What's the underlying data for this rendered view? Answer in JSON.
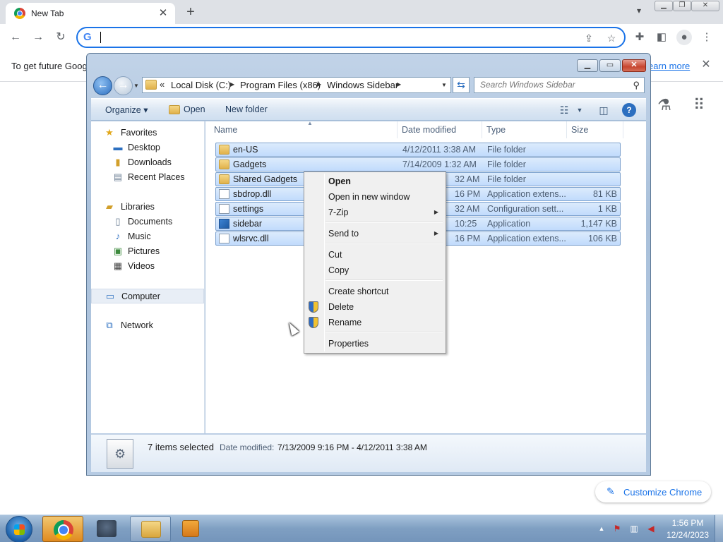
{
  "chrome": {
    "tab_title": "New Tab",
    "omnibox_value": "",
    "infobar_text": "To get future Goog",
    "infobar_link": "earn more",
    "customize_label": "Customize Chrome"
  },
  "explorer": {
    "breadcrumb": [
      "Local Disk (C:)",
      "Program Files (x86)",
      "Windows Sidebar"
    ],
    "search_placeholder": "Search Windows Sidebar",
    "commands": {
      "organize": "Organize",
      "open": "Open",
      "new_folder": "New folder"
    },
    "nav": {
      "favorites": "Favorites",
      "desktop": "Desktop",
      "downloads": "Downloads",
      "recent_places": "Recent Places",
      "libraries": "Libraries",
      "documents": "Documents",
      "music": "Music",
      "pictures": "Pictures",
      "videos": "Videos",
      "computer": "Computer",
      "network": "Network"
    },
    "columns": {
      "name": "Name",
      "date": "Date modified",
      "type": "Type",
      "size": "Size"
    },
    "files": [
      {
        "name": "en-US",
        "date": "4/12/2011 3:38 AM",
        "type": "File folder",
        "size": ""
      },
      {
        "name": "Gadgets",
        "date": "7/14/2009 1:32 AM",
        "type": "File folder",
        "size": ""
      },
      {
        "name": "Shared Gadgets",
        "date": "32 AM",
        "type": "File folder",
        "size": ""
      },
      {
        "name": "sbdrop.dll",
        "date": "16 PM",
        "type": "Application extens...",
        "size": "81 KB"
      },
      {
        "name": "settings",
        "date": "32 AM",
        "type": "Configuration sett...",
        "size": "1 KB"
      },
      {
        "name": "sidebar",
        "date": "10:25",
        "type": "Application",
        "size": "1,147 KB"
      },
      {
        "name": "wlsrvc.dll",
        "date": "16 PM",
        "type": "Application extens...",
        "size": "106 KB"
      }
    ],
    "details": {
      "count": "7 items selected",
      "date_label": "Date modified:",
      "date_value": "7/13/2009 9:16 PM - 4/12/2011 3:38 AM"
    }
  },
  "context_menu": {
    "open": "Open",
    "open_new_window": "Open in new window",
    "seven_zip": "7-Zip",
    "send_to": "Send to",
    "cut": "Cut",
    "copy": "Copy",
    "create_shortcut": "Create shortcut",
    "delete": "Delete",
    "rename": "Rename",
    "properties": "Properties"
  },
  "taskbar": {
    "time": "1:56 PM",
    "date": "12/24/2023"
  },
  "colors": {
    "selection_fill": "#c1dbfc",
    "selection_border": "#7da2ce",
    "chrome_accent": "#1a73e8"
  }
}
